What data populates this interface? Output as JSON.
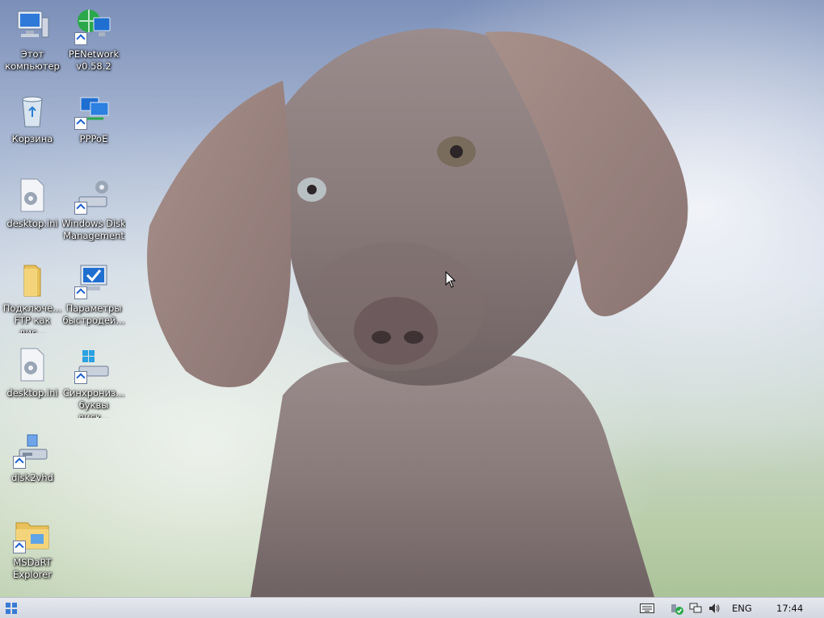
{
  "desktop": {
    "icons": [
      {
        "label": "Этот компьютер",
        "icon": "computer-icon",
        "shortcut": false
      },
      {
        "label": "PENetwork v0.58.2",
        "icon": "network-globe-icon",
        "shortcut": true
      },
      {
        "label": "Корзина",
        "icon": "recycle-bin-icon",
        "shortcut": false
      },
      {
        "label": "PPPoE",
        "icon": "network-connection-icon",
        "shortcut": true
      },
      {
        "label": "desktop.ini",
        "icon": "settings-file-icon",
        "shortcut": false
      },
      {
        "label": "Windows Disk Management",
        "icon": "disk-management-icon",
        "shortcut": true
      },
      {
        "label": "Подключе... FTP как дис...",
        "icon": "folder-icon",
        "shortcut": false
      },
      {
        "label": "Параметры быстродей...",
        "icon": "performance-settings-icon",
        "shortcut": true
      },
      {
        "label": "desktop.ini",
        "icon": "settings-file-icon",
        "shortcut": false
      },
      {
        "label": "Синхрониз... буквы диск...",
        "icon": "drive-sync-icon",
        "shortcut": true
      },
      {
        "label": "disk2vhd",
        "icon": "disk2vhd-icon",
        "shortcut": true
      },
      {
        "label": "MSDaRT Explorer",
        "icon": "explorer-folder-icon",
        "shortcut": true
      }
    ]
  },
  "taskbar": {
    "start_icon": "windows-logo-icon",
    "tray": {
      "keyboard_icon": "keyboard-icon",
      "security_icon": "security-shield-icon",
      "network_icon": "network-icon",
      "volume_icon": "speaker-icon",
      "language": "ENG",
      "clock": "17:44"
    }
  },
  "colors": {
    "taskbar_bg": "#d9dce4",
    "label_text": "#ffffff",
    "dog_coat": "#8d7f80"
  }
}
